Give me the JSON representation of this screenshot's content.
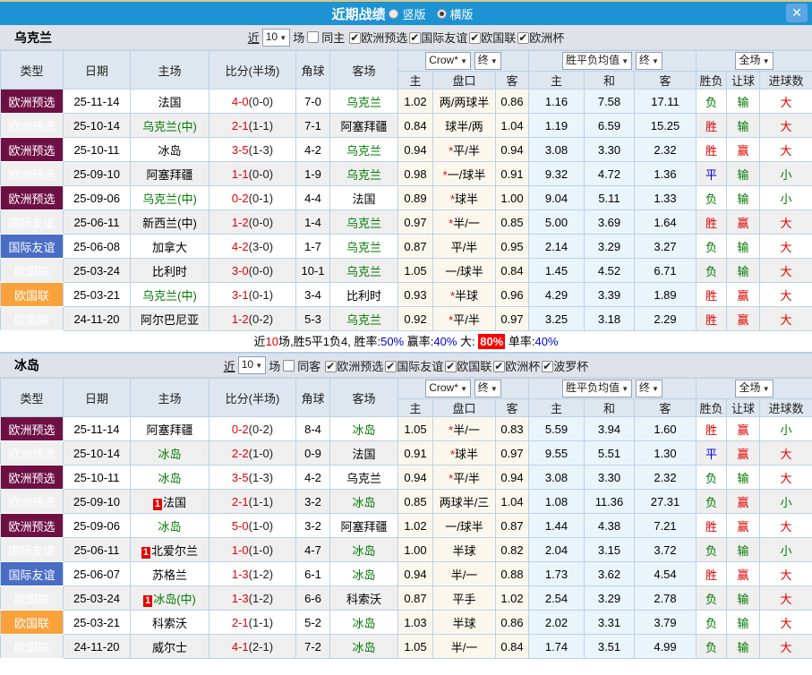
{
  "titlebar": {
    "title": "近期战绩",
    "radio_vertical": "竖版",
    "radio_horizontal": "横版",
    "close": "✕"
  },
  "columns": {
    "type": "类型",
    "date": "日期",
    "home": "主场",
    "score": "比分(半场)",
    "corner": "角球",
    "away": "客场",
    "odds_group": "Crow*",
    "final": "终",
    "avg_group": "胜平负均值",
    "full_group": "全场",
    "odds_home": "主",
    "handicap": "盘口",
    "odds_away": "客",
    "avg_home": "主",
    "avg_draw": "和",
    "avg_away": "客",
    "result": "胜负",
    "handicap_result": "让球",
    "goals": "进球数"
  },
  "colors": {
    "title_bar": "#1e93d4",
    "qualifier_tag": "#6e1044",
    "friendly_tag": "#4a6dc6",
    "nations_league_tag": "#f9a13a",
    "win_red": "#e60000",
    "lose_green": "#007a00",
    "draw_blue": "#0000dc",
    "highlight_bg": "#ff0000",
    "odds_col_bg": "#fcf7ed",
    "avg_col_bg": "#eaf4fb"
  },
  "sections": [
    {
      "team": "乌克兰",
      "filter": {
        "near": "近",
        "count": "10",
        "unit": "场",
        "same": "同主",
        "same_checked": false,
        "leagues": [
          "欧洲预选",
          "国际友谊",
          "欧国联",
          "欧洲杯"
        ]
      },
      "rows": [
        {
          "type": "欧洲预选",
          "tc": "maroon",
          "date": "25-11-14",
          "home": "法国",
          "hg": false,
          "badge": "",
          "score": "4-0",
          "half": "(0-0)",
          "corner": "7-0",
          "away": "乌克兰",
          "ag": true,
          "o1": "1.02",
          "hc": "两/两球半",
          "o2": "0.86",
          "a1": "1.16",
          "a2": "7.58",
          "a3": "17.11",
          "r": "负",
          "rc": "green",
          "l": "输",
          "lc": "green",
          "g": "大",
          "gc": "red"
        },
        {
          "type": "欧洲预选",
          "tc": "maroon",
          "date": "25-10-14",
          "home": "乌克兰(中)",
          "hg": true,
          "badge": "",
          "score": "2-1",
          "half": "(1-1)",
          "corner": "7-1",
          "away": "阿塞拜疆",
          "ag": false,
          "o1": "0.84",
          "hc": "球半/两",
          "o2": "1.04",
          "a1": "1.19",
          "a2": "6.59",
          "a3": "15.25",
          "r": "胜",
          "rc": "red",
          "l": "输",
          "lc": "green",
          "g": "大",
          "gc": "red"
        },
        {
          "type": "欧洲预选",
          "tc": "maroon",
          "date": "25-10-11",
          "home": "冰岛",
          "hg": false,
          "badge": "",
          "score": "3-5",
          "half": "(1-3)",
          "corner": "4-2",
          "away": "乌克兰",
          "ag": true,
          "o1": "0.94",
          "hc": "*平/半",
          "o2": "0.94",
          "a1": "3.08",
          "a2": "3.30",
          "a3": "2.32",
          "r": "胜",
          "rc": "red",
          "l": "赢",
          "lc": "red",
          "g": "大",
          "gc": "red"
        },
        {
          "type": "欧洲预选",
          "tc": "maroon",
          "date": "25-09-10",
          "home": "阿塞拜疆",
          "hg": false,
          "badge": "",
          "score": "1-1",
          "half": "(0-0)",
          "corner": "1-9",
          "away": "乌克兰",
          "ag": true,
          "o1": "0.98",
          "hc": "*一/球半",
          "o2": "0.91",
          "a1": "9.32",
          "a2": "4.72",
          "a3": "1.36",
          "r": "平",
          "rc": "blue",
          "l": "输",
          "lc": "green",
          "g": "小",
          "gc": "green"
        },
        {
          "type": "欧洲预选",
          "tc": "maroon",
          "date": "25-09-06",
          "home": "乌克兰(中)",
          "hg": true,
          "badge": "",
          "score": "0-2",
          "half": "(0-1)",
          "corner": "4-4",
          "away": "法国",
          "ag": false,
          "o1": "0.89",
          "hc": "*球半",
          "o2": "1.00",
          "a1": "9.04",
          "a2": "5.11",
          "a3": "1.33",
          "r": "负",
          "rc": "green",
          "l": "输",
          "lc": "green",
          "g": "小",
          "gc": "green"
        },
        {
          "type": "国际友谊",
          "tc": "blue",
          "date": "25-06-11",
          "home": "新西兰(中)",
          "hg": false,
          "badge": "",
          "score": "1-2",
          "half": "(0-0)",
          "corner": "1-4",
          "away": "乌克兰",
          "ag": true,
          "o1": "0.97",
          "hc": "*半/一",
          "o2": "0.85",
          "a1": "5.00",
          "a2": "3.69",
          "a3": "1.64",
          "r": "胜",
          "rc": "red",
          "l": "赢",
          "lc": "red",
          "g": "大",
          "gc": "red"
        },
        {
          "type": "国际友谊",
          "tc": "blue",
          "date": "25-06-08",
          "home": "加拿大",
          "hg": false,
          "badge": "",
          "score": "4-2",
          "half": "(3-0)",
          "corner": "1-7",
          "away": "乌克兰",
          "ag": true,
          "o1": "0.87",
          "hc": "平/半",
          "o2": "0.95",
          "a1": "2.14",
          "a2": "3.29",
          "a3": "3.27",
          "r": "负",
          "rc": "green",
          "l": "输",
          "lc": "green",
          "g": "大",
          "gc": "red"
        },
        {
          "type": "欧国联",
          "tc": "orange",
          "date": "25-03-24",
          "home": "比利时",
          "hg": false,
          "badge": "",
          "score": "3-0",
          "half": "(0-0)",
          "corner": "10-1",
          "away": "乌克兰",
          "ag": true,
          "o1": "1.05",
          "hc": "一/球半",
          "o2": "0.84",
          "a1": "1.45",
          "a2": "4.52",
          "a3": "6.71",
          "r": "负",
          "rc": "green",
          "l": "输",
          "lc": "green",
          "g": "大",
          "gc": "red"
        },
        {
          "type": "欧国联",
          "tc": "orange",
          "date": "25-03-21",
          "home": "乌克兰(中)",
          "hg": true,
          "badge": "",
          "score": "3-1",
          "half": "(0-1)",
          "corner": "3-4",
          "away": "比利时",
          "ag": false,
          "o1": "0.93",
          "hc": "*半球",
          "o2": "0.96",
          "a1": "4.29",
          "a2": "3.39",
          "a3": "1.89",
          "r": "胜",
          "rc": "red",
          "l": "赢",
          "lc": "red",
          "g": "大",
          "gc": "red"
        },
        {
          "type": "欧国联",
          "tc": "orange",
          "date": "24-11-20",
          "home": "阿尔巴尼亚",
          "hg": false,
          "badge": "",
          "score": "1-2",
          "half": "(0-2)",
          "corner": "5-3",
          "away": "乌克兰",
          "ag": true,
          "o1": "0.92",
          "hc": "*平/半",
          "o2": "0.97",
          "a1": "3.25",
          "a2": "3.18",
          "a3": "2.29",
          "r": "胜",
          "rc": "red",
          "l": "赢",
          "lc": "red",
          "g": "大",
          "gc": "red"
        }
      ],
      "summary": [
        {
          "t": "近",
          "s": "plain"
        },
        {
          "t": "10",
          "s": "red"
        },
        {
          "t": "场,胜5平1负4, 胜率:",
          "s": "plain"
        },
        {
          "t": "50%",
          "s": "blue"
        },
        {
          "t": " 赢率:",
          "s": "plain"
        },
        {
          "t": "40%",
          "s": "blue"
        },
        {
          "t": " 大: ",
          "s": "plain"
        },
        {
          "t": "80%",
          "s": "hl"
        },
        {
          "t": " 单率:",
          "s": "plain"
        },
        {
          "t": "40%",
          "s": "blue"
        }
      ]
    },
    {
      "team": "冰岛",
      "filter": {
        "near": "近",
        "count": "10",
        "unit": "场",
        "same": "同客",
        "same_checked": false,
        "leagues": [
          "欧洲预选",
          "国际友谊",
          "欧国联",
          "欧洲杯",
          "波罗杯"
        ]
      },
      "rows": [
        {
          "type": "欧洲预选",
          "tc": "maroon",
          "date": "25-11-14",
          "home": "阿塞拜疆",
          "hg": false,
          "badge": "",
          "score": "0-2",
          "half": "(0-2)",
          "corner": "8-4",
          "away": "冰岛",
          "ag": true,
          "o1": "1.05",
          "hc": "*半/一",
          "o2": "0.83",
          "a1": "5.59",
          "a2": "3.94",
          "a3": "1.60",
          "r": "胜",
          "rc": "red",
          "l": "赢",
          "lc": "red",
          "g": "小",
          "gc": "green"
        },
        {
          "type": "欧洲预选",
          "tc": "maroon",
          "date": "25-10-14",
          "home": "冰岛",
          "hg": true,
          "badge": "",
          "score": "2-2",
          "half": "(1-0)",
          "corner": "0-9",
          "away": "法国",
          "ag": false,
          "o1": "0.91",
          "hc": "*球半",
          "o2": "0.97",
          "a1": "9.55",
          "a2": "5.51",
          "a3": "1.30",
          "r": "平",
          "rc": "blue",
          "l": "赢",
          "lc": "red",
          "g": "大",
          "gc": "red"
        },
        {
          "type": "欧洲预选",
          "tc": "maroon",
          "date": "25-10-11",
          "home": "冰岛",
          "hg": true,
          "badge": "",
          "score": "3-5",
          "half": "(1-3)",
          "corner": "4-2",
          "away": "乌克兰",
          "ag": false,
          "o1": "0.94",
          "hc": "*平/半",
          "o2": "0.94",
          "a1": "3.08",
          "a2": "3.30",
          "a3": "2.32",
          "r": "负",
          "rc": "green",
          "l": "输",
          "lc": "green",
          "g": "大",
          "gc": "red"
        },
        {
          "type": "欧洲预选",
          "tc": "maroon",
          "date": "25-09-10",
          "home": "法国",
          "hg": false,
          "badge": "1",
          "score": "2-1",
          "half": "(1-1)",
          "corner": "3-2",
          "away": "冰岛",
          "ag": true,
          "o1": "0.85",
          "hc": "两球半/三",
          "o2": "1.04",
          "a1": "1.08",
          "a2": "11.36",
          "a3": "27.31",
          "r": "负",
          "rc": "green",
          "l": "赢",
          "lc": "red",
          "g": "小",
          "gc": "green"
        },
        {
          "type": "欧洲预选",
          "tc": "maroon",
          "date": "25-09-06",
          "home": "冰岛",
          "hg": true,
          "badge": "",
          "score": "5-0",
          "half": "(1-0)",
          "corner": "3-2",
          "away": "阿塞拜疆",
          "ag": false,
          "o1": "1.02",
          "hc": "一/球半",
          "o2": "0.87",
          "a1": "1.44",
          "a2": "4.38",
          "a3": "7.21",
          "r": "胜",
          "rc": "red",
          "l": "赢",
          "lc": "red",
          "g": "大",
          "gc": "red"
        },
        {
          "type": "国际友谊",
          "tc": "blue",
          "date": "25-06-11",
          "home": "北爱尔兰",
          "hg": false,
          "badge": "1",
          "score": "1-0",
          "half": "(1-0)",
          "corner": "4-7",
          "away": "冰岛",
          "ag": true,
          "o1": "1.00",
          "hc": "半球",
          "o2": "0.82",
          "a1": "2.04",
          "a2": "3.15",
          "a3": "3.72",
          "r": "负",
          "rc": "green",
          "l": "输",
          "lc": "green",
          "g": "小",
          "gc": "green"
        },
        {
          "type": "国际友谊",
          "tc": "blue",
          "date": "25-06-07",
          "home": "苏格兰",
          "hg": false,
          "badge": "",
          "score": "1-3",
          "half": "(1-2)",
          "corner": "6-1",
          "away": "冰岛",
          "ag": true,
          "o1": "0.94",
          "hc": "半/一",
          "o2": "0.88",
          "a1": "1.73",
          "a2": "3.62",
          "a3": "4.54",
          "r": "胜",
          "rc": "red",
          "l": "赢",
          "lc": "red",
          "g": "大",
          "gc": "red"
        },
        {
          "type": "欧国联",
          "tc": "orange",
          "date": "25-03-24",
          "home": "冰岛(中)",
          "hg": true,
          "badge": "1",
          "score": "1-3",
          "half": "(1-2)",
          "corner": "6-6",
          "away": "科索沃",
          "ag": false,
          "o1": "0.87",
          "hc": "平手",
          "o2": "1.02",
          "a1": "2.54",
          "a2": "3.29",
          "a3": "2.78",
          "r": "负",
          "rc": "green",
          "l": "输",
          "lc": "green",
          "g": "大",
          "gc": "red"
        },
        {
          "type": "欧国联",
          "tc": "orange",
          "date": "25-03-21",
          "home": "科索沃",
          "hg": false,
          "badge": "",
          "score": "2-1",
          "half": "(1-1)",
          "corner": "5-2",
          "away": "冰岛",
          "ag": true,
          "o1": "1.03",
          "hc": "半球",
          "o2": "0.86",
          "a1": "2.02",
          "a2": "3.31",
          "a3": "3.79",
          "r": "负",
          "rc": "green",
          "l": "输",
          "lc": "green",
          "g": "大",
          "gc": "red"
        },
        {
          "type": "欧国联",
          "tc": "orange",
          "date": "24-11-20",
          "home": "威尔士",
          "hg": false,
          "badge": "",
          "score": "4-1",
          "half": "(2-1)",
          "corner": "7-2",
          "away": "冰岛",
          "ag": true,
          "o1": "1.05",
          "hc": "半/一",
          "o2": "0.84",
          "a1": "1.74",
          "a2": "3.51",
          "a3": "4.99",
          "r": "负",
          "rc": "green",
          "l": "输",
          "lc": "green",
          "g": "大",
          "gc": "red"
        }
      ],
      "summary": null
    }
  ]
}
